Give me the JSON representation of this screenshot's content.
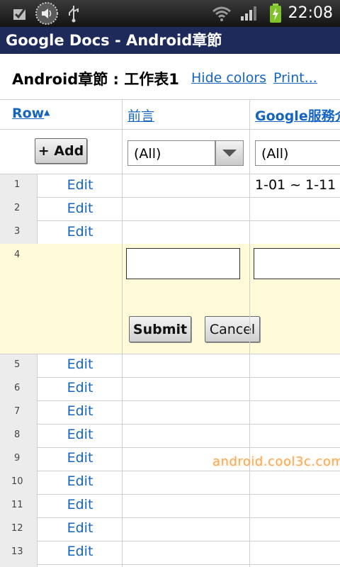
{
  "status_bar": {
    "time": "22:08",
    "icons": [
      "checkbox-notification-icon",
      "volume-icon",
      "usb-icon",
      "wifi-icon",
      "signal-icon",
      "battery-charging-icon"
    ]
  },
  "app": {
    "title": "Google Docs - Android章節"
  },
  "sheet": {
    "title": "Android章節 : 工作表1",
    "hide_colors": "Hide colors",
    "print": "Print..."
  },
  "columns": {
    "row": "Row",
    "c1": "前言",
    "c2": "Google服務介"
  },
  "controls": {
    "add_label": "+ Add",
    "filter1": "(All)",
    "filter2": "(All)",
    "submit_label": "Submit",
    "cancel_label": "Cancel"
  },
  "rows": [
    {
      "num": "1",
      "edit": "Edit",
      "c1": "",
      "c2": "1-01 ~ 1-11"
    },
    {
      "num": "2",
      "edit": "Edit",
      "c1": "",
      "c2": ""
    },
    {
      "num": "3",
      "edit": "Edit",
      "c1": "",
      "c2": ""
    },
    {
      "num": "4"
    },
    {
      "num": "5",
      "edit": "Edit"
    },
    {
      "num": "6",
      "edit": "Edit"
    },
    {
      "num": "7",
      "edit": "Edit"
    },
    {
      "num": "8",
      "edit": "Edit"
    },
    {
      "num": "9",
      "edit": "Edit"
    },
    {
      "num": "10",
      "edit": "Edit"
    },
    {
      "num": "11",
      "edit": "Edit"
    },
    {
      "num": "12",
      "edit": "Edit"
    },
    {
      "num": "13",
      "edit": "Edit"
    }
  ],
  "watermark": "android.cool3c.com",
  "colors": {
    "title_bar": "#1d2a5a",
    "link": "#1565c0",
    "new_row_bg": "#fffbd9"
  }
}
